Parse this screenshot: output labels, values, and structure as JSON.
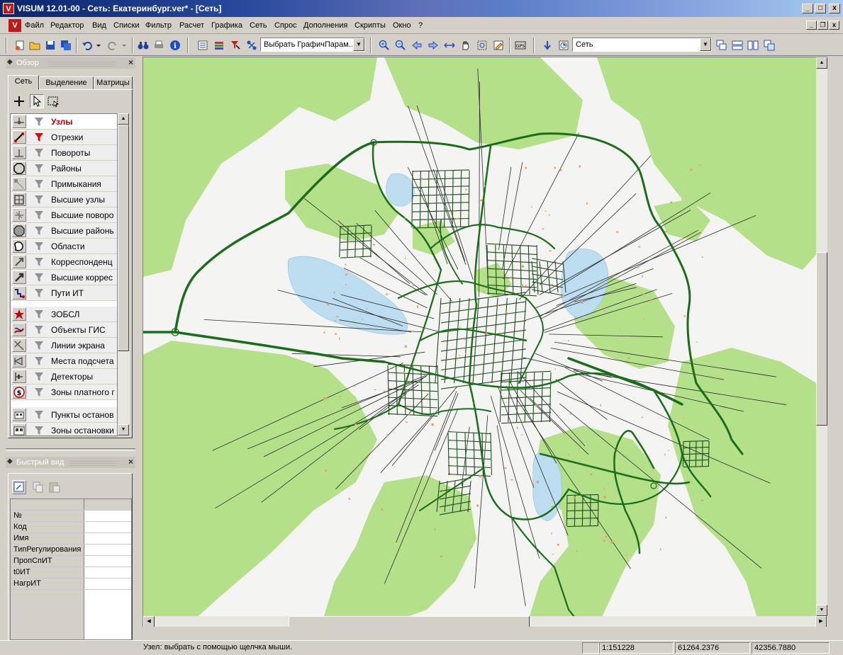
{
  "window": {
    "title": "VISUM 12.01-00 - Сеть: Екатеринбург.ver* - [Сеть]",
    "app_icon": "visum-logo-icon",
    "minimize_label": "_",
    "maximize_label": "□",
    "close_label": "x"
  },
  "menu": {
    "items": [
      "Файл",
      "Редактор",
      "Вид",
      "Списки",
      "Фильтр",
      "Расчет",
      "Графика",
      "Сеть",
      "Спрос",
      "Дополнения",
      "Скрипты",
      "Окно",
      "?"
    ]
  },
  "toolbar": {
    "graphic_params_combo": "Выбрать ГрафичПарам...",
    "layer_combo": "Сеть"
  },
  "overview_panel": {
    "title": "Обзор",
    "tabs": [
      "Сеть",
      "Выделение",
      "Матрицы"
    ],
    "active_tab": "Сеть",
    "layers": [
      {
        "name": "Узлы",
        "icon": "node-icon",
        "selected": true
      },
      {
        "name": "Отрезки",
        "icon": "link-icon",
        "filter_active": true
      },
      {
        "name": "Повороты",
        "icon": "turn-icon"
      },
      {
        "name": "Районы",
        "icon": "zone-icon"
      },
      {
        "name": "Примыкания",
        "icon": "connector-icon"
      },
      {
        "name": "Высшие узлы",
        "icon": "main-node-icon"
      },
      {
        "name": "Высшие поворо",
        "icon": "main-turn-icon"
      },
      {
        "name": "Высшие районь",
        "icon": "main-zone-icon"
      },
      {
        "name": "Области",
        "icon": "territory-icon"
      },
      {
        "name": "Корреспонденц",
        "icon": "od-pair-icon"
      },
      {
        "name": "Высшие коррес",
        "icon": "main-od-pair-icon"
      },
      {
        "name": "Пути ИТ",
        "icon": "path-icon"
      },
      {
        "name": "ЗОБСЛ",
        "icon": "poi-star-icon"
      },
      {
        "name": "Объекты ГИС",
        "icon": "gis-object-icon"
      },
      {
        "name": "Линии экрана",
        "icon": "screenline-icon"
      },
      {
        "name": "Места подсчета",
        "icon": "count-location-icon"
      },
      {
        "name": "Детекторы",
        "icon": "detector-icon"
      },
      {
        "name": "Зоны платного г",
        "icon": "toll-zone-icon"
      },
      {
        "name": "Пункты останов",
        "icon": "stop-point-icon"
      },
      {
        "name": "Зоны остановки",
        "icon": "stop-area-icon"
      }
    ]
  },
  "quick_view_panel": {
    "title": "Быстрый вид",
    "rows": [
      "№",
      "Код",
      "Имя",
      "ТипРегулирования",
      "ПропСпИТ",
      "t0ИТ",
      "НагрИТ"
    ]
  },
  "statusbar": {
    "message": "Узел: выбрать с помощью щелчка мыши.",
    "scale": "1:151228",
    "x_coord": "61264.2376",
    "y_coord": "42356.7880"
  },
  "colors": {
    "forest": "#b4e08a",
    "water": "#bcdcf0",
    "major_road": "#1a6e1a",
    "minor_road": "#2a2a2a",
    "selected_layer_text": "#c00000"
  }
}
